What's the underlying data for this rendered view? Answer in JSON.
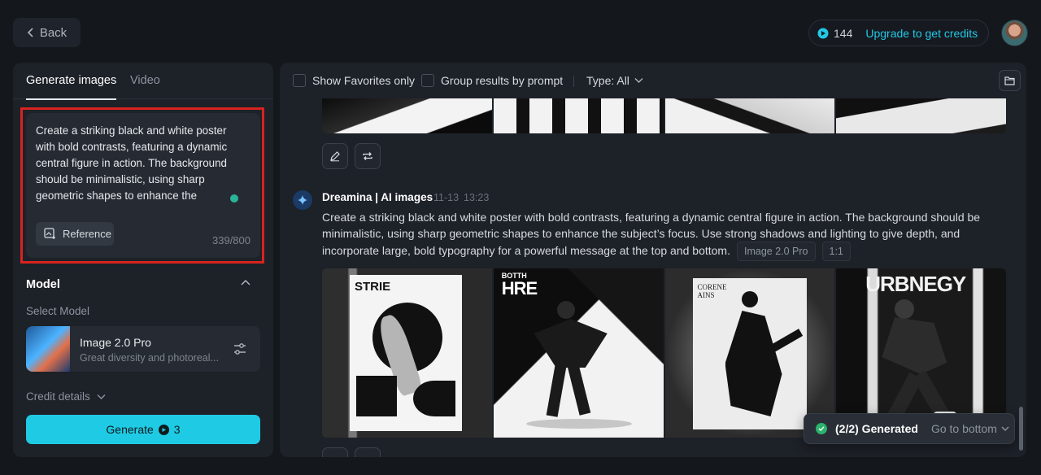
{
  "header": {
    "back_label": "Back",
    "credits": "144",
    "upgrade_label": "Upgrade to get credits"
  },
  "left_panel": {
    "tabs": [
      {
        "label": "Generate images",
        "active": true
      },
      {
        "label": "Video",
        "active": false
      }
    ],
    "prompt": {
      "text": "Create a striking black and white poster with bold contrasts, featuring a dynamic central figure in action. The background should be minimalistic, using sharp geometric shapes to enhance the subject's focus. Use strong shadows and lighting to give depth, and incorporate large, bold typography for a powerful message at the top and bottom.",
      "reference_label": "Reference",
      "char_count": "339/800"
    },
    "model_section": {
      "title": "Model",
      "select_label": "Select Model",
      "model_name": "Image 2.0 Pro",
      "model_desc": "Great diversity and photoreal...",
      "credit_details_label": "Credit details"
    },
    "generate": {
      "label": "Generate",
      "cost": "3"
    }
  },
  "filters": {
    "show_favorites_label": "Show Favorites only",
    "group_results_label": "Group results by prompt",
    "type_label": "Type: All"
  },
  "result": {
    "author": "Dreamina | AI images",
    "date": "11-13",
    "time": "13:23",
    "prompt": "Create a striking black and white poster with bold contrasts, featuring a dynamic central figure in action. The background should be minimalistic, using sharp geometric shapes to enhance the subject’s focus. Use strong shadows and lighting to give depth, and incorporate large, bold typography for a powerful message at the top and bottom.",
    "model_tag": "Image 2.0 Pro",
    "ratio_tag": "1:1",
    "posters": [
      {
        "headline": "STRIE"
      },
      {
        "headline": "HRE",
        "subline": "BOTTH"
      },
      {
        "headline": "CORENE AINS"
      },
      {
        "headline": "URBNEGY"
      }
    ]
  },
  "toast": {
    "status": "(2/2) Generated",
    "link": "Go to bottom"
  },
  "colors": {
    "accent": "#1fcbe4",
    "highlight_box": "#d8231f",
    "success": "#2bb36d"
  }
}
